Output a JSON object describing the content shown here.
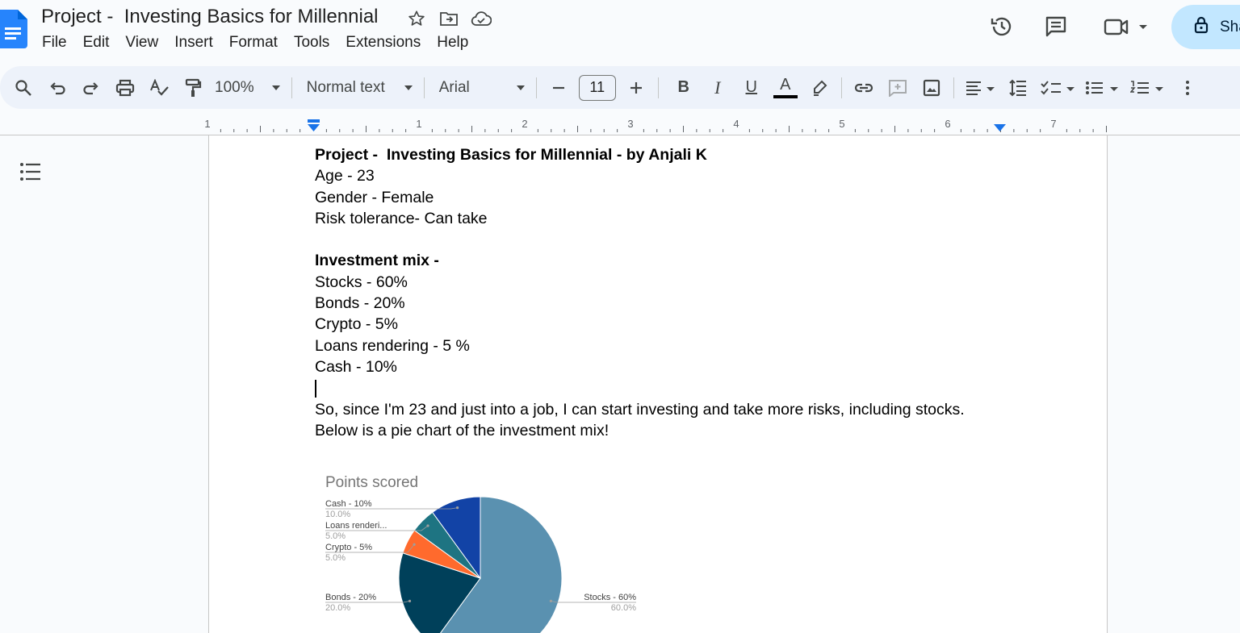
{
  "doc": {
    "title": "Project -  Investing Basics for Millennial",
    "menu": [
      "File",
      "Edit",
      "View",
      "Insert",
      "Format",
      "Tools",
      "Extensions",
      "Help"
    ],
    "share_label": "Sha"
  },
  "toolbar": {
    "zoom": "100%",
    "style": "Normal text",
    "font": "Arial",
    "font_size": "11",
    "bold": "B",
    "italic": "I",
    "underline": "U",
    "text_color": "A"
  },
  "ruler": {
    "labels": [
      "1",
      "1",
      "2",
      "3",
      "4",
      "5",
      "6",
      "7"
    ]
  },
  "content": {
    "heading": "Project -  Investing Basics for Millennial - by Anjali K",
    "age": "Age - 23",
    "gender": "Gender - Female",
    "risk": "Risk tolerance- Can take",
    "mix_heading": "Investment mix -",
    "stocks": "Stocks - 60%",
    "bonds": "Bonds - 20%",
    "crypto": "Crypto - 5%",
    "loans": "Loans rendering - 5 %",
    "cash": "Cash - 10%",
    "para1": "So, since I'm 23 and just into a job, I can start investing and take more risks, including stocks.",
    "para2": "Below is a pie chart of the investment mix!"
  },
  "chart_data": {
    "type": "pie",
    "title": "Points scored",
    "categories": [
      "Stocks - 60%",
      "Bonds - 20%",
      "Crypto - 5%",
      "Loans renderi...",
      "Cash - 10%"
    ],
    "values": [
      60,
      20,
      5,
      5,
      10
    ],
    "percent_labels": [
      "60.0%",
      "20.0%",
      "5.0%",
      "5.0%",
      "10.0%"
    ],
    "colors": [
      "#5a91b0",
      "#00405a",
      "#ff6a2d",
      "#1e7482",
      "#1243a6"
    ]
  }
}
